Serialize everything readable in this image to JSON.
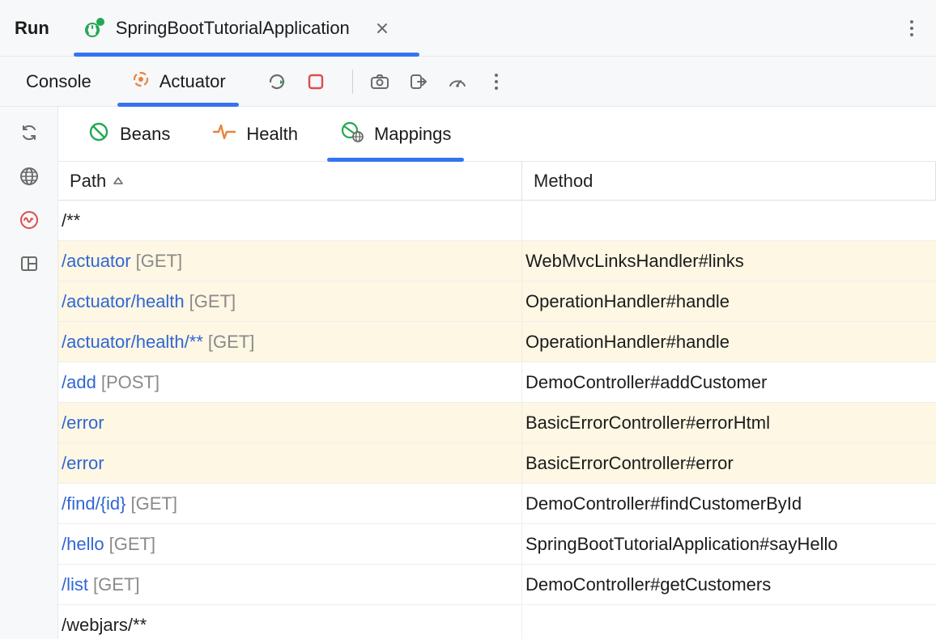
{
  "topBar": {
    "runLabel": "Run",
    "configName": "SpringBootTutorialApplication"
  },
  "toolbar": {
    "consoleLabel": "Console",
    "actuatorLabel": "Actuator"
  },
  "subTabs": {
    "beans": "Beans",
    "health": "Health",
    "mappings": "Mappings"
  },
  "table": {
    "headers": {
      "path": "Path",
      "method": "Method"
    },
    "rows": [
      {
        "path": "/**",
        "verb": "",
        "method": "",
        "link": false,
        "hl": false
      },
      {
        "path": "/actuator",
        "verb": "[GET]",
        "method": "WebMvcLinksHandler#links",
        "link": true,
        "hl": true
      },
      {
        "path": "/actuator/health",
        "verb": "[GET]",
        "method": "OperationHandler#handle",
        "link": true,
        "hl": true
      },
      {
        "path": "/actuator/health/**",
        "verb": "[GET]",
        "method": "OperationHandler#handle",
        "link": true,
        "hl": true
      },
      {
        "path": "/add",
        "verb": "[POST]",
        "method": "DemoController#addCustomer",
        "link": true,
        "hl": false
      },
      {
        "path": "/error",
        "verb": "",
        "method": "BasicErrorController#errorHtml",
        "link": true,
        "hl": true
      },
      {
        "path": "/error",
        "verb": "",
        "method": "BasicErrorController#error",
        "link": true,
        "hl": true
      },
      {
        "path": "/find/{id}",
        "verb": "[GET]",
        "method": "DemoController#findCustomerById",
        "link": true,
        "hl": false
      },
      {
        "path": "/hello",
        "verb": "[GET]",
        "method": "SpringBootTutorialApplication#sayHello",
        "link": true,
        "hl": false
      },
      {
        "path": "/list",
        "verb": "[GET]",
        "method": "DemoController#getCustomers",
        "link": true,
        "hl": false
      },
      {
        "path": "/webjars/**",
        "verb": "",
        "method": "",
        "link": false,
        "hl": false
      }
    ]
  }
}
